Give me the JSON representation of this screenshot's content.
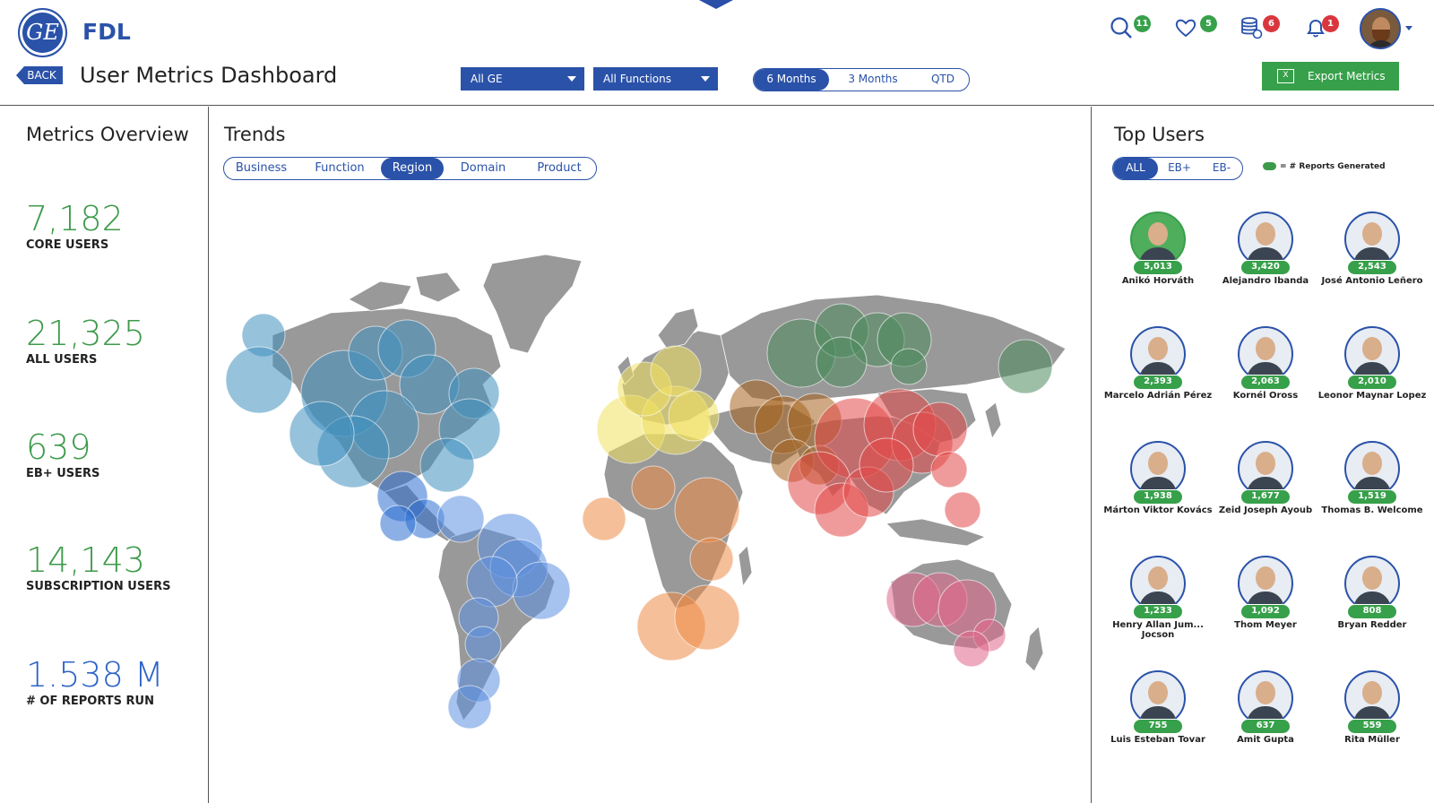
{
  "app": {
    "name": "FDL",
    "logo_text": "GE"
  },
  "header": {
    "back_label": "BACK",
    "title": "User Metrics Dashboard",
    "filter_org": "All GE",
    "filter_function": "All Functions",
    "time_options": [
      "6 Months",
      "3 Months",
      "QTD"
    ],
    "time_selected": "6 Months",
    "export_label": "Export Metrics",
    "notifications": {
      "search": "11",
      "favorites": "5",
      "reports": "6",
      "alerts": "1"
    }
  },
  "metrics": {
    "title": "Metrics Overview",
    "items": [
      {
        "value": "7,182",
        "label": "CORE USERS"
      },
      {
        "value": "21,325",
        "label": "ALL USERS"
      },
      {
        "value": "639",
        "label": "EB+ USERS"
      },
      {
        "value": "14,143",
        "label": "SUBSCRIPTION USERS"
      },
      {
        "value": "1.538 M",
        "label": "# OF REPORTS RUN"
      }
    ]
  },
  "trends": {
    "title": "Trends",
    "tabs": [
      "Business",
      "Function",
      "Region",
      "Domain",
      "Product"
    ],
    "selected_tab": "Region",
    "region_colors": {
      "north_america": "#3f8fc0",
      "central_america": "#2e6fd2",
      "south_america": "#5c8fe0",
      "europe": "#f0e060",
      "russia": "#4d8a5c",
      "middle_east": "#a5621e",
      "africa": "#ec8a45",
      "asia": "#e14848",
      "oceania": "#e0668a"
    }
  },
  "top_users": {
    "title": "Top Users",
    "filters": [
      "ALL",
      "EB+",
      "EB-"
    ],
    "selected_filter": "ALL",
    "legend": "= # Reports Generated",
    "users": [
      {
        "count": "5,013",
        "name": "Anikó Horváth"
      },
      {
        "count": "3,420",
        "name": "Alejandro Ibanda"
      },
      {
        "count": "2,543",
        "name": "José Antonio Leñero"
      },
      {
        "count": "2,393",
        "name": "Marcelo Adrián Pérez"
      },
      {
        "count": "2,063",
        "name": "Kornél Oross"
      },
      {
        "count": "2,010",
        "name": "Leonor Maynar Lopez"
      },
      {
        "count": "1,938",
        "name": "Márton Viktor Kovács"
      },
      {
        "count": "1,677",
        "name": "Zeid Joseph Ayoub"
      },
      {
        "count": "1,519",
        "name": "Thomas B. Welcome"
      },
      {
        "count": "1,233",
        "name": "Henry Allan Jum... Jocson"
      },
      {
        "count": "1,092",
        "name": "Thom Meyer"
      },
      {
        "count": "808",
        "name": "Bryan Redder"
      },
      {
        "count": "755",
        "name": "Luis Esteban Tovar"
      },
      {
        "count": "637",
        "name": "Amit Gupta"
      },
      {
        "count": "559",
        "name": "Rita Müller"
      }
    ]
  }
}
